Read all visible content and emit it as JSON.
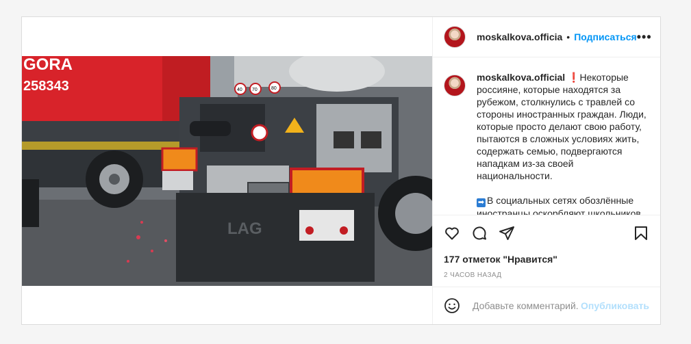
{
  "header": {
    "username": "moskalkova.officia",
    "dot": "•",
    "follow_label": "Подписаться",
    "more_label": "•••"
  },
  "caption": {
    "username": "moskalkova.official",
    "red_mark": "❗",
    "paragraph1": "Некоторые россияне, которые находятся за рубежом, столкнулись с травлей со стороны иностранных граждан. Люди, которые просто делают свою работу, пытаются в сложных условиях жить, содержать семью, подвергаются нападкам из-за своей национальности.",
    "blue_mark": "➡",
    "paragraph2": "В социальных сетях обозлённые иностранцы оскорбляют школьников"
  },
  "photo": {
    "sign_text_1": "GORA",
    "sign_text_2": "258343",
    "speed_signs": [
      "40",
      "70",
      "80"
    ],
    "plate_text": "LAG"
  },
  "actions": {
    "likes": "177 отметок \"Нравится\"",
    "time": "2 часов назад"
  },
  "comment": {
    "placeholder": "Добавьте комментарий...",
    "publish_label": "Опубликовать"
  },
  "icons": {
    "like": "heart-icon",
    "comment": "comment-icon",
    "share": "share-icon",
    "save": "bookmark-icon",
    "emoji": "emoji-icon"
  },
  "colors": {
    "accent": "#0095f6",
    "publish_disabled": "#b2dffc",
    "muted": "#8e8e8e",
    "truck_red": "#d8232a"
  }
}
